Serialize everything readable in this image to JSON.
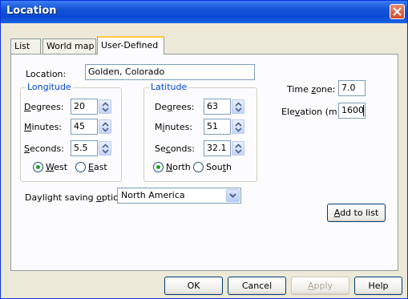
{
  "window": {
    "title": "Location"
  },
  "tabs": [
    {
      "label": "List"
    },
    {
      "label": "World map"
    },
    {
      "label": "User-Defined"
    }
  ],
  "location": {
    "label": "Location:",
    "value": "Golden, Colorado"
  },
  "longitude": {
    "group_label": "Longitude",
    "degrees": {
      "label_u": "D",
      "label_rest": "egrees:",
      "value": "20"
    },
    "minutes": {
      "label_u": "M",
      "label_rest": "inutes:",
      "value": "45"
    },
    "seconds": {
      "label_u": "S",
      "label_rest": "econds:",
      "value": "5.5"
    },
    "west": {
      "label_u": "W",
      "label_rest": "est",
      "selected": true
    },
    "east": {
      "label_u": "E",
      "label_rest": "ast",
      "selected": false
    }
  },
  "latitude": {
    "group_label": "Latitude",
    "degrees": {
      "label_pre": "De",
      "label_u": "g",
      "label_rest": "rees:",
      "value": "63"
    },
    "minutes": {
      "label_pre": "M",
      "label_u": "i",
      "label_rest": "nutes:",
      "value": "51"
    },
    "seconds": {
      "label_pre": "Se",
      "label_u": "c",
      "label_rest": "onds:",
      "value": "32.1"
    },
    "north": {
      "label_u": "N",
      "label_rest": "orth",
      "selected": true
    },
    "south": {
      "label_pre": "Sou",
      "label_u": "t",
      "label_rest": "h",
      "selected": false
    }
  },
  "timezone": {
    "label_pre": "Time ",
    "label_u": "z",
    "label_rest": "one:",
    "value": "7.0"
  },
  "elevation": {
    "label_pre": "Ele",
    "label_u": "v",
    "label_rest": "ation (m):",
    "value": "1600"
  },
  "daylight": {
    "label_pre": "Daylight saving ",
    "label_u": "o",
    "label_rest": "ption:",
    "value": "North America"
  },
  "add_to_list": {
    "label_u": "A",
    "label_rest": "dd to list"
  },
  "buttons": {
    "ok": "OK",
    "cancel": "Cancel",
    "apply_u": "A",
    "apply_rest": "pply",
    "help": "Help"
  },
  "colors": {
    "title_bar": "#0a4ad2",
    "group_label": "#0046d5",
    "dialog_bg": "#ece9d8",
    "tab_highlight": "#ffc83c"
  }
}
